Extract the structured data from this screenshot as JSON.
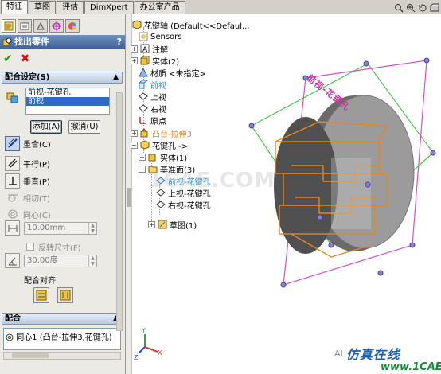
{
  "tabs": [
    "特征",
    "草图",
    "评估",
    "DimXpert",
    "办公室产品"
  ],
  "property_manager": {
    "title": "找出零件",
    "help": "?",
    "ok": "✔",
    "cancel": "✖"
  },
  "mate_settings": {
    "group_label": "配合设定(S)",
    "selections": [
      "前视-花键孔",
      "前视"
    ],
    "add_button": "添加(A)",
    "cancel_button": "撤消(U)"
  },
  "mate_types": [
    {
      "label": "重合(C)",
      "enabled": true,
      "selected": true
    },
    {
      "label": "平行(P)",
      "enabled": true,
      "selected": false
    },
    {
      "label": "垂直(P)",
      "enabled": true,
      "selected": false
    },
    {
      "label": "相切(T)",
      "enabled": false,
      "selected": false
    },
    {
      "label": "同心(C)",
      "enabled": false,
      "selected": false
    }
  ],
  "distance_value": "10.00mm",
  "flip_label": "反转尺寸(F)",
  "angle_value": "30.00度",
  "mate_align_label": "配合对齐",
  "mates_group": {
    "label": "配合",
    "items": [
      "同心1 (凸台-拉伸3,花键孔)"
    ]
  },
  "tree": {
    "root": "花键轴  (Default<<Defaul...",
    "nodes": [
      {
        "label": "Sensors",
        "style": "normal"
      },
      {
        "label": "注解",
        "style": "normal"
      },
      {
        "label": "实体(2)",
        "style": "normal"
      },
      {
        "label": "材质 <未指定>",
        "style": "normal"
      },
      {
        "label": "前视",
        "style": "highlight"
      },
      {
        "label": "上视",
        "style": "normal"
      },
      {
        "label": "右视",
        "style": "normal"
      },
      {
        "label": "原点",
        "style": "normal"
      },
      {
        "label": "凸台-拉伸3",
        "style": "orange"
      },
      {
        "label": "花键孔 ->",
        "style": "normal"
      },
      {
        "label": "实体(1)",
        "style": "normal"
      },
      {
        "label": "基准面(3)",
        "style": "normal"
      },
      {
        "label": "前视-花键孔",
        "style": "highlight"
      },
      {
        "label": "上视-花键孔",
        "style": "normal"
      },
      {
        "label": "右视-花键孔",
        "style": "normal"
      },
      {
        "label": "草图(1)",
        "style": "normal"
      }
    ]
  },
  "model_labels": {
    "text_on_model": "前视-花键孔"
  },
  "watermark": {
    "brand": "仿真在线",
    "url": "www.1CAE.com",
    "faint": "1CAE.COM",
    "small": "AI"
  },
  "colors": {
    "accent": "#3d5f95",
    "highlight": "#1e9ad6",
    "orange": "#e8851a",
    "plane_pink": "#d84fbf",
    "plane_green": "#44cc44"
  }
}
